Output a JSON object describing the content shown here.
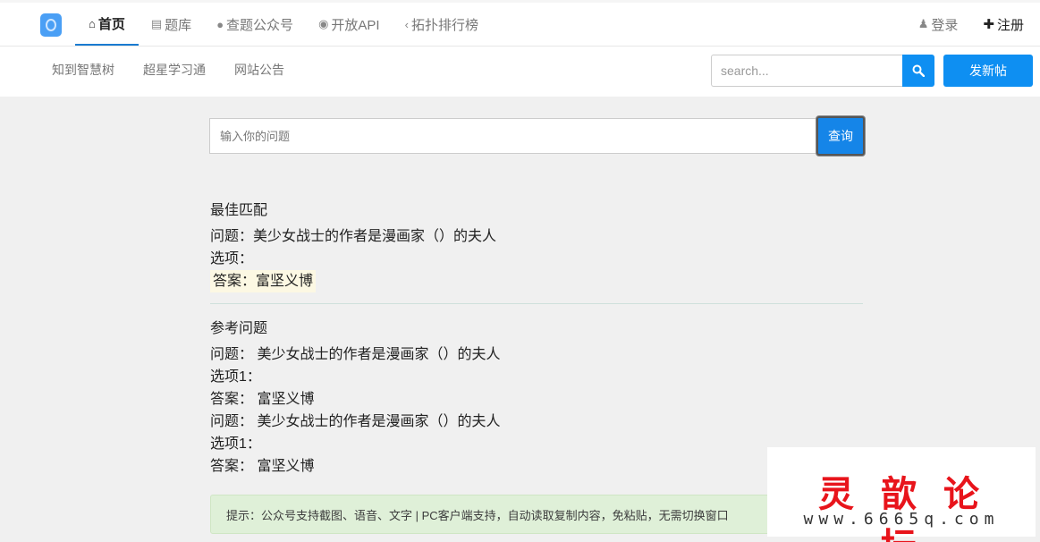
{
  "nav": {
    "items": [
      {
        "icon": "home-icon",
        "glyph": "⌂",
        "label": "首页",
        "active": true
      },
      {
        "icon": "book-icon",
        "glyph": "▤",
        "label": "题库",
        "active": false
      },
      {
        "icon": "wechat-icon",
        "glyph": "●",
        "label": "查题公众号",
        "active": false
      },
      {
        "icon": "github-icon",
        "glyph": "◉",
        "label": "开放API",
        "active": false
      },
      {
        "icon": "share-icon",
        "glyph": "‹",
        "label": "拓扑排行榜",
        "active": false
      }
    ],
    "login": {
      "icon": "user-icon",
      "glyph": "♟",
      "label": "登录"
    },
    "register": {
      "icon": "plus-icon",
      "glyph": "✚",
      "label": "注册"
    }
  },
  "subnav": {
    "items": [
      "知到智慧树",
      "超星学习通",
      "网站公告"
    ],
    "search_placeholder": "search...",
    "search_icon": "search-icon",
    "new_post_label": "发新帖"
  },
  "question_form": {
    "placeholder": "输入你的问题",
    "submit_label": "查询"
  },
  "best_match": {
    "heading": "最佳匹配",
    "question": "问题：美少女战士的作者是漫画家（）的夫人",
    "options": "选项：",
    "answer": "答案：富坚义博"
  },
  "reference": {
    "heading": "参考问题",
    "items": [
      {
        "question": "问题： 美少女战士的作者是漫画家（）的夫人",
        "options": "选项1：",
        "answer": "答案： 富坚义博"
      },
      {
        "question": "问题： 美少女战士的作者是漫画家（）的夫人",
        "options": "选项1：",
        "answer": "答案： 富坚义博"
      }
    ]
  },
  "tip": "提示：公众号支持截图、语音、文字 | PC客户端支持，自动读取复制内容，免粘贴，无需切换窗口",
  "watermark": {
    "title": "灵歆论坛",
    "url": "www.6665q.com"
  },
  "colors": {
    "primary": "#0e8ff2",
    "active_underline": "#1a7bd1",
    "answer_highlight": "#fcf8e3",
    "tip_background": "#dff0d8",
    "watermark_red": "#e8141b"
  }
}
